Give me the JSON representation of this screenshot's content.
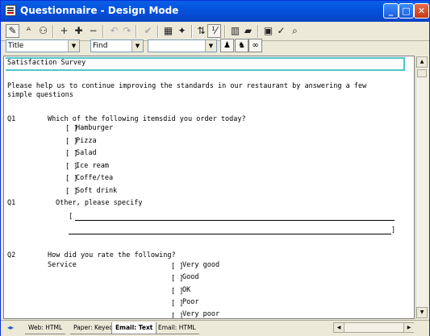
{
  "window": {
    "title": "Questionnaire - Design Mode"
  },
  "toolbar2": {
    "style_combo": "Title",
    "find_combo": "Find",
    "search_combo": ""
  },
  "doc": {
    "title": "Satisfaction Survey",
    "intro_line1": "Please help us to continue improving the standards in our restaurant by answering a few",
    "intro_line2": "simple questions",
    "q1_label": "Q1",
    "q1_text": "Which of the following itemsdid you order today?",
    "q1_options": [
      "Hamburger",
      "Pizza",
      "Salad",
      "Ice ream",
      "Coffe/tea",
      "Soft drink"
    ],
    "q1b_label": "Q1",
    "q1b_text": "Other, please specify",
    "bracket_open": "[",
    "bracket_close": "]",
    "q2_label": "Q2",
    "q2_text": "How did you rate the following?",
    "q2_sub": "Service",
    "q2_options": [
      "Very good",
      "Good",
      "OK",
      "Poor",
      "Very poor"
    ],
    "checkbox": "[ ]"
  },
  "tabs": [
    "Web: HTML",
    "Paper: Keyed",
    "Email: Text",
    "Email: HTML"
  ],
  "active_tab": "Email: Text"
}
